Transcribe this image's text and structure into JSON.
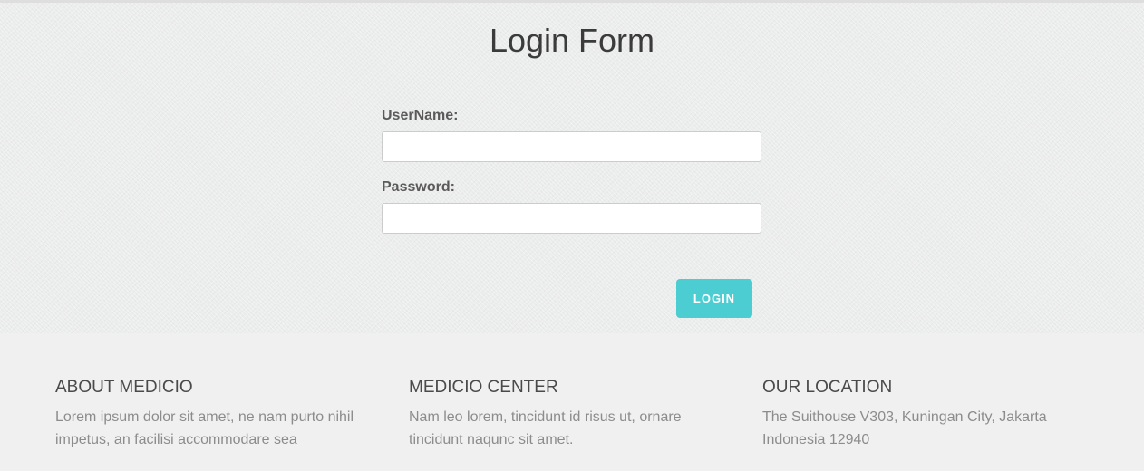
{
  "page": {
    "title": "Login Form"
  },
  "form": {
    "username_label": "UserName:",
    "username_value": "",
    "password_label": "Password:",
    "password_value": "",
    "login_button": "LOGIN"
  },
  "footer": {
    "columns": [
      {
        "heading": "ABOUT MEDICIO",
        "text": "Lorem ipsum dolor sit amet, ne nam purto nihil impetus, an facilisi accommodare sea"
      },
      {
        "heading": "MEDICIO CENTER",
        "text": "Nam leo lorem, tincidunt id risus ut, ornare tincidunt naqunc sit amet."
      },
      {
        "heading": "OUR LOCATION",
        "text": "The Suithouse V303, Kuningan City, Jakarta Indonesia 12940"
      }
    ]
  },
  "colors": {
    "accent": "#4ccdd1",
    "background": "#ebecec",
    "footer_background": "#f0f0f0"
  }
}
